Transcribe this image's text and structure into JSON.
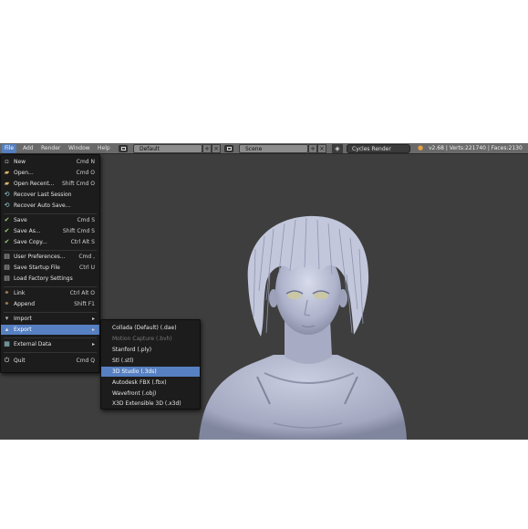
{
  "menubar": {
    "tabs": [
      "File",
      "Add",
      "Render",
      "Window",
      "Help"
    ],
    "layout": "Default",
    "scene": "Scene",
    "render_engine": "Cycles Render",
    "stats": "v2.68 | Verts:221740 | Faces:2130"
  },
  "file_menu": {
    "items": [
      {
        "label": "New",
        "shortcut": "Cmd N",
        "icon": "new-file-icon"
      },
      {
        "label": "Open...",
        "shortcut": "Cmd O",
        "icon": "folder-open-icon"
      },
      {
        "label": "Open Recent...",
        "shortcut": "Shift Cmd O",
        "icon": "folder-recent-icon"
      },
      {
        "label": "Recover Last Session",
        "shortcut": "",
        "icon": "recover-icon"
      },
      {
        "label": "Recover Auto Save...",
        "shortcut": "",
        "icon": "recover-auto-icon"
      },
      {
        "label": "Save",
        "shortcut": "Cmd S",
        "icon": "save-check-icon"
      },
      {
        "label": "Save As...",
        "shortcut": "Shift Cmd S",
        "icon": "save-as-icon"
      },
      {
        "label": "Save Copy...",
        "shortcut": "Ctrl Alt S",
        "icon": "save-copy-icon"
      },
      {
        "label": "User Preferences...",
        "shortcut": "Cmd ,",
        "icon": "preferences-icon"
      },
      {
        "label": "Save Startup File",
        "shortcut": "Ctrl U",
        "icon": "save-startup-icon"
      },
      {
        "label": "Load Factory Settings",
        "shortcut": "",
        "icon": "factory-settings-icon"
      },
      {
        "label": "Link",
        "shortcut": "Ctrl Alt O",
        "icon": "link-icon"
      },
      {
        "label": "Append",
        "shortcut": "Shift F1",
        "icon": "append-icon"
      },
      {
        "label": "Import",
        "shortcut": "",
        "icon": "import-icon"
      },
      {
        "label": "Export",
        "shortcut": "",
        "icon": "export-icon"
      },
      {
        "label": "External Data",
        "shortcut": "",
        "icon": "external-data-icon"
      },
      {
        "label": "Quit",
        "shortcut": "Cmd Q",
        "icon": "power-icon"
      }
    ]
  },
  "export_menu": {
    "items": [
      {
        "label": "Collada (Default) (.dae)"
      },
      {
        "label": "Motion Capture (.bvh)"
      },
      {
        "label": "Stanford (.ply)"
      },
      {
        "label": "Stl (.stl)"
      },
      {
        "label": "3D Studio (.3ds)"
      },
      {
        "label": "Autodesk FBX (.fbx)"
      },
      {
        "label": "Wavefront (.obj)"
      },
      {
        "label": "X3D Extensible 3D (.x3d)"
      }
    ]
  },
  "colors": {
    "highlight": "#5680c2",
    "menu_bg": "#1c1c1c",
    "viewport_bg": "#3e3e3e",
    "model": "#b5bad2"
  }
}
